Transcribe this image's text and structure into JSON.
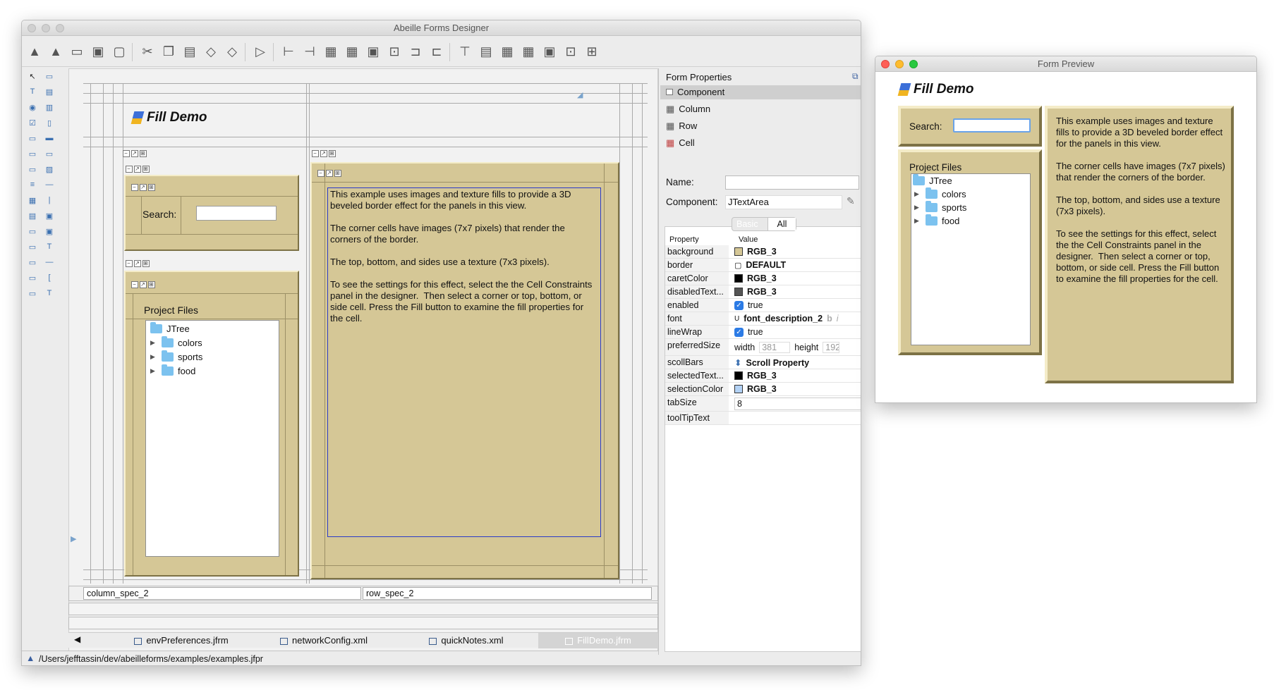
{
  "designer": {
    "title": "Abeille Forms Designer",
    "form_title": "Fill Demo",
    "search_label": "Search:",
    "project_files_label": "Project Files",
    "tree_root": "JTree",
    "tree_items": [
      "colors",
      "sports",
      "food"
    ],
    "textarea_text": "This example uses images and texture fills to provide a 3D beveled border effect for the panels in this view.\n\nThe corner cells have images (7x7 pixels) that render the corners of the border.\n\nThe top, bottom, and sides use a texture (7x3 pixels).\n\nTo see the settings for this effect, select the the Cell Constraints panel in the designer.  Then select a corner or top, bottom, or side cell. Press the Fill button to examine the fill properties for the cell.",
    "column_spec": "column_spec_2",
    "row_spec": "row_spec_2",
    "tabs": [
      "envPreferences.jfrm",
      "networkConfig.xml",
      "quickNotes.xml",
      "FillDemo.jfrm"
    ],
    "status_path": "/Users/jefftassin/dev/abeilleforms/examples/examples.jfpr"
  },
  "properties": {
    "header": "Form Properties",
    "tree_nodes": [
      "Component",
      "Column",
      "Row",
      "Cell"
    ],
    "name_label": "Name:",
    "name_value": "",
    "component_label": "Component:",
    "component_value": "JTextArea",
    "mode_tabs": [
      "Basic",
      "All"
    ],
    "col_property": "Property",
    "col_value": "Value",
    "rows": [
      {
        "name": "background",
        "value": "RGB_3",
        "kind": "color",
        "swatch": "#d5c796"
      },
      {
        "name": "border",
        "value": "DEFAULT",
        "kind": "border"
      },
      {
        "name": "caretColor",
        "value": "RGB_3",
        "kind": "color",
        "swatch": "#000000"
      },
      {
        "name": "disabledText...",
        "value": "RGB_3",
        "kind": "color",
        "swatch": "#555555"
      },
      {
        "name": "enabled",
        "value": "true",
        "kind": "check"
      },
      {
        "name": "font",
        "value": "font_description_2",
        "kind": "font"
      },
      {
        "name": "lineWrap",
        "value": "true",
        "kind": "check"
      },
      {
        "name": "preferredSize",
        "value": "",
        "kind": "size"
      },
      {
        "name": "scollBars",
        "value": "Scroll Property",
        "kind": "scroll"
      },
      {
        "name": "selectedText...",
        "value": "RGB_3",
        "kind": "color",
        "swatch": "#000000"
      },
      {
        "name": "selectionColor",
        "value": "RGB_3",
        "kind": "color",
        "swatch": "#b3d2f5"
      },
      {
        "name": "tabSize",
        "value": "8",
        "kind": "field"
      },
      {
        "name": "toolTipText",
        "value": "",
        "kind": "empty"
      }
    ],
    "size_width_label": "width",
    "size_width": "381",
    "size_height_label": "height",
    "size_height": "192",
    "font_bold": "b",
    "font_italic": "i"
  },
  "preview": {
    "title": "Form Preview",
    "form_title": "Fill Demo",
    "search_label": "Search:",
    "project_files_label": "Project Files",
    "tree_root": "JTree",
    "tree_items": [
      "colors",
      "sports",
      "food"
    ],
    "text": "This example uses images and texture fills to provide a 3D beveled border effect for the panels in this view.\n\nThe corner cells have images (7x7 pixels) that render the corners of the border.\n\nThe top, bottom, and sides use a texture (7x3 pixels).\n\nTo see the settings for this effect, select the the Cell Constraints panel in the designer.  Then select a corner or top, bottom, or side cell. Press the Fill button to examine the fill properties for the cell."
  },
  "colors": {
    "tan": "#d5c796",
    "selection_blue": "#2c7be5",
    "close_red": "#fe5f57",
    "minimize_yellow": "#febc2e",
    "zoom_green": "#28c840"
  }
}
